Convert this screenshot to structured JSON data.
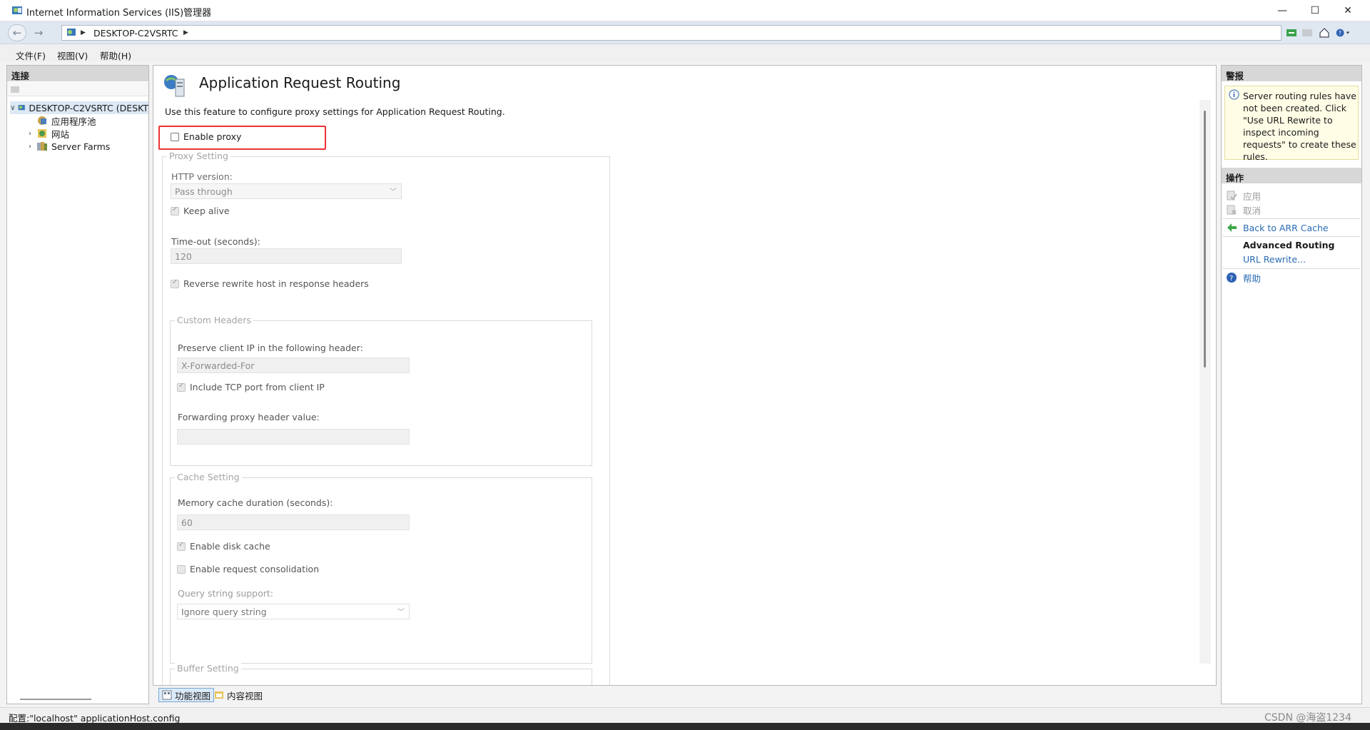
{
  "window": {
    "title": "Internet Information Services (IIS)管理器",
    "controls": {
      "minimize": "—",
      "maximize": "☐",
      "close": "✕"
    }
  },
  "address": {
    "path": "DESKTOP-C2VSRTC",
    "back_icon": "back-arrow-icon",
    "forward_icon": "forward-arrow-icon"
  },
  "menu": {
    "items": [
      "文件(F)",
      "视图(V)",
      "帮助(H)"
    ]
  },
  "connections": {
    "header": "连接",
    "tree": [
      {
        "label": "DESKTOP-C2VSRTC (DESKT",
        "icon": "server-icon",
        "expanded": true,
        "selected": true
      },
      {
        "label": "应用程序池",
        "icon": "app-pool-icon"
      },
      {
        "label": "网站",
        "icon": "sites-icon"
      },
      {
        "label": "Server Farms",
        "icon": "server-farm-icon"
      }
    ]
  },
  "feature": {
    "title": "Application Request Routing",
    "description": "Use this feature to configure proxy settings for Application Request Routing.",
    "enable_proxy": {
      "label": "Enable proxy",
      "checked": false
    },
    "proxy_setting": {
      "title": "Proxy Setting",
      "http_version_label": "HTTP version:",
      "http_version_value": "Pass through",
      "keep_alive": {
        "label": "Keep alive",
        "checked": true
      },
      "timeout_label": "Time-out (seconds):",
      "timeout_value": "120",
      "reverse_rewrite": {
        "label": "Reverse rewrite host in response headers",
        "checked": true
      }
    },
    "custom_headers": {
      "title": "Custom Headers",
      "preserve_ip_label": "Preserve client IP in the following header:",
      "preserve_ip_value": "X-Forwarded-For",
      "include_tcp_port": {
        "label": "Include TCP port from client IP",
        "checked": true
      },
      "forwarding_label": "Forwarding proxy header value:",
      "forwarding_value": ""
    },
    "cache_setting": {
      "title": "Cache Setting",
      "memory_cache_label": "Memory cache duration (seconds):",
      "memory_cache_value": "60",
      "disk_cache": {
        "label": "Enable disk cache",
        "checked": true
      },
      "request_consolidation": {
        "label": "Enable request consolidation",
        "checked": false
      },
      "query_string_label": "Query string support:",
      "query_string_value": "Ignore query string"
    },
    "buffer_setting": {
      "title": "Buffer Setting"
    }
  },
  "bottom_tabs": [
    "功能视图",
    "内容视图"
  ],
  "actions": {
    "alerts_header": "警报",
    "alert_text": "Server routing rules have not been created. Click \"Use URL Rewrite to inspect incoming requests\" to create these rules.",
    "ops_header": "操作",
    "apply": "应用",
    "cancel": "取消",
    "back_to_arr": "Back to ARR Cache",
    "advanced_routing": "Advanced Routing",
    "url_rewrite": "URL Rewrite...",
    "help": "帮助"
  },
  "status": {
    "text": "配置:\"localhost\" applicationHost.config"
  },
  "watermark": "CSDN @海盗1234",
  "colors": {
    "highlight": "#e33333",
    "link": "#2a6bb5",
    "accent": "#d7d7d7"
  }
}
